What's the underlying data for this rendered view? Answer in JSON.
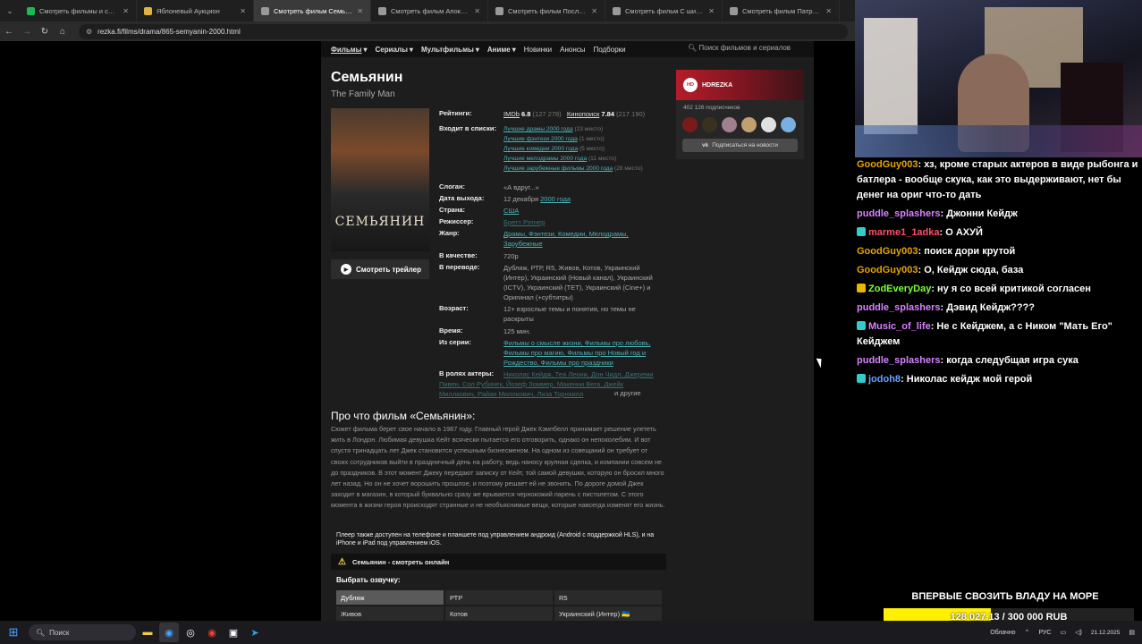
{
  "browser": {
    "tabs": [
      {
        "title": "Смотреть фильмы и сериалы",
        "active": false,
        "favicon_color": "#1db954"
      },
      {
        "title": "Яблоневый Аукцион",
        "active": false,
        "favicon_color": "#e0b341"
      },
      {
        "title": "Смотреть фильм Семьянин",
        "active": true,
        "favicon_color": "#999999"
      },
      {
        "title": "Смотреть фильм Апокалипсис",
        "active": false,
        "favicon_color": "#999999"
      },
      {
        "title": "Смотреть фильм Последний",
        "active": false,
        "favicon_color": "#999999"
      },
      {
        "title": "Смотреть фильм С широко",
        "active": false,
        "favicon_color": "#999999"
      },
      {
        "title": "Смотреть фильм Патруль вре",
        "active": false,
        "favicon_color": "#999999"
      }
    ],
    "url": "rezka.fi/films/drama/865-semyanin-2000.html"
  },
  "site": {
    "nav": [
      "Фильмы",
      "Сериалы",
      "Мультфильмы",
      "Аниме",
      "Новинки",
      "Анонсы",
      "Подборки"
    ],
    "search_placeholder": "Поиск фильмов и сериалов"
  },
  "movie": {
    "title": "Семьянин",
    "original_title": "The Family Man",
    "poster_text": "СЕМЬЯНИН",
    "trailer_label": "Смотреть трейлер",
    "labels": {
      "ratings": "Рейтинги:",
      "lists": "Входит в списки:",
      "slogan": "Слоган:",
      "release": "Дата выхода:",
      "country": "Страна:",
      "director": "Режиссер:",
      "genre": "Жанр:",
      "quality": "В качестве:",
      "translation": "В переводе:",
      "age": "Возраст:",
      "time": "Время:",
      "series": "Из серии:",
      "cast": "В ролях актеры:"
    },
    "imdb_label": "IMDb",
    "imdb_score": "6.8",
    "imdb_votes": "(127 278)",
    "kp_label": "Кинопоиск",
    "kp_score": "7.84",
    "kp_votes": "(217 190)",
    "lists": [
      {
        "name": "Лучшие драмы 2000 года",
        "place": "(23 место)"
      },
      {
        "name": "Лучшие фэнтези 2000 года",
        "place": "(1 место)"
      },
      {
        "name": "Лучшие комедии 2000 года",
        "place": "(5 место)"
      },
      {
        "name": "Лучшие мелодрамы 2000 года",
        "place": "(11 место)"
      },
      {
        "name": "Лучшие зарубежные фильмы 2000 года",
        "place": "(28 место)"
      }
    ],
    "slogan": "«А вдруг...»",
    "release_day": "12 декабря",
    "release_year": "2000 года",
    "country": "США",
    "director": "Бретт Рэтнер",
    "genres": "Драмы, Фэнтези, Комедии, Мелодрамы, Зарубежные",
    "quality": "720p",
    "translation": "Дубляж, РТР, R5, Живов, Котов, Украинский (Интер), Украинский (Новый канал), Украинский (ICTV), Украинский (ТЕТ), Украинский (Cine+) и Оригинал (+субтитры)",
    "age": "12+ взрослые темы и понятия, но темы не раскрыты",
    "time": "125 мин.",
    "series": "Фильмы о смысле жизни, Фильмы про любовь, Фильмы про магию, Фильмы про Новый год и Рождество, Фильмы про праздники",
    "cast": "Николас Кейдж, Теа Леони, Дон Чидл, Джереми Пивен, Сол Рубинек, Йозеф Зоммер, Макенни Вега, Джейк Миллкович, Райан Миллкович, Лиза Торнхилл",
    "cast_suffix": "и другие",
    "about_title": "Про что фильм «Семьянин»:",
    "story": "Сюжет фильма берет свое начало в 1987 году. Главный герой Джек Кэмпбелл принимает решение улететь жить в Лондон. Любимая девушка Кейт всячески пытается его отговорить, однако он непоколебим. И вот спустя тринадцать лет Джек становится успешным бизнесменом. На одном из совещаний он требует от своих сотрудников выйти в праздничный день на работу, ведь наносу крупная сделка, и компании совсем не до праздников. В этот момент Джеку передают записку от Кейт, той самой девушки, которую он бросил много лет назад. Но он не хочет ворошить прошлое, и поэтому решает ей не звонить. По дороге домой Джек заходит в магазин, в который буквально сразу же врывается чернокожий парень с пистолетом. С этого момента в жизни героя происходят странные и не необъяснимые вещи, которые навсегда изменят его жизнь.",
    "notice": "Плеер также доступен на телефоне и планшете под управлением андроид (Android с поддержкой HLS), и на iPhone и iPad под управлением iOS.",
    "watch_label": "Семьянин - смотреть онлайн",
    "voice_label": "Выбрать озвучку:",
    "voices": [
      "Дубляж",
      "РТР",
      "R5",
      "Живов",
      "Котов",
      "Украинский (Интер) 🇺🇦"
    ]
  },
  "sidebar": {
    "name": "HDREZKA",
    "logo_text": "HD",
    "subscribers": "402 126 подписчиков",
    "vk_button": "Подписаться на новости",
    "avatar_colors": [
      "#7a1b1b",
      "#3a3020",
      "#a08090",
      "#c0a070",
      "#e0e0e0",
      "#7ab0e0"
    ]
  },
  "chat": [
    {
      "user": "GoodGuy003",
      "color": "#e6a400",
      "badge": "",
      "text": ": хз, кроме старых актеров в виде рыбонга и батлера - вообще скука, как это выдерживают, нет бы денег на ориг что-то дать"
    },
    {
      "user": "puddle_splashers",
      "color": "#d782ff",
      "badge": "",
      "text": ": Джонни Кейдж"
    },
    {
      "user": "marme1_1adka",
      "color": "#ff4f6a",
      "badge": "#3cc",
      "text": ": О АХУЙ"
    },
    {
      "user": "GoodGuy003",
      "color": "#e6a400",
      "badge": "",
      "text": ": поиск дори крутой"
    },
    {
      "user": "GoodGuy003",
      "color": "#e6a400",
      "badge": "",
      "text": ": О, Кейдж сюда, база"
    },
    {
      "user": "ZodEveryDay",
      "color": "#7cff3c",
      "badge": "#e6b800",
      "text": ": ну я со всей критикой согласен"
    },
    {
      "user": "puddle_splashers",
      "color": "#d782ff",
      "badge": "",
      "text": ": Дэвид Кейдж????"
    },
    {
      "user": "Music_of_life",
      "color": "#d782ff",
      "badge": "#3cc",
      "text": ": Не с Кейджем, а с Ником \"Мать Его\" Кейджем"
    },
    {
      "user": "puddle_splashers",
      "color": "#d782ff",
      "badge": "",
      "text": ": когда следубщая игра сука"
    },
    {
      "user": "jodoh8",
      "color": "#6aa2ff",
      "badge": "#3cc",
      "text": ": Николас кейдж мой герой"
    }
  ],
  "donation": {
    "title": "ВПЕРВЫЕ СВОЗИТЬ ВЛАДУ НА МОРЕ",
    "amount": "128 027.13 / 300 000 RUB",
    "progress": 0.43
  },
  "taskbar": {
    "search": "Поиск",
    "weather": "Облачно",
    "lang": "РУС",
    "time": "",
    "date": "21.12.2025"
  }
}
